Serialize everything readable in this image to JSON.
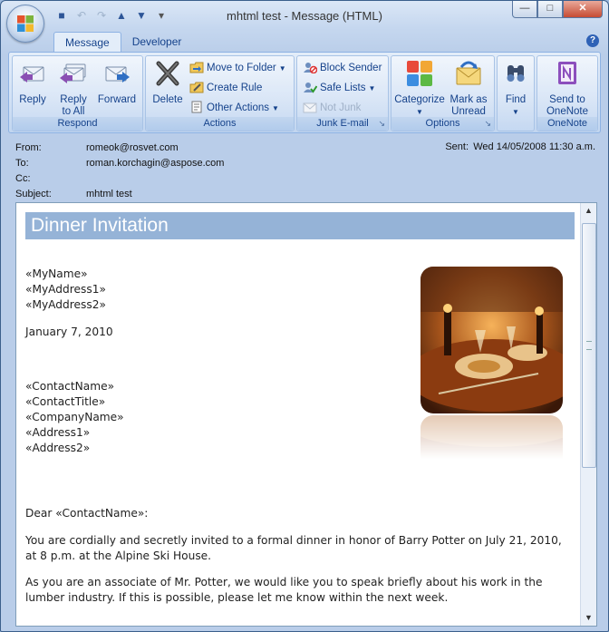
{
  "window": {
    "title": "mhtml test - Message (HTML)"
  },
  "tabs": [
    {
      "label": "Message"
    },
    {
      "label": "Developer"
    }
  ],
  "ribbon": {
    "respond": {
      "label": "Respond",
      "reply": "Reply",
      "reply_all_1": "Reply",
      "reply_all_2": "to All",
      "forward": "Forward"
    },
    "actions": {
      "label": "Actions",
      "delete": "Delete",
      "move_to_folder": "Move to Folder",
      "create_rule": "Create Rule",
      "other_actions": "Other Actions"
    },
    "junk": {
      "label": "Junk E-mail",
      "block_sender": "Block Sender",
      "safe_lists": "Safe Lists",
      "not_junk": "Not Junk"
    },
    "options": {
      "label": "Options",
      "categorize": "Categorize",
      "mark_as_1": "Mark as",
      "mark_as_2": "Unread"
    },
    "find": {
      "label": "Find"
    },
    "onenote": {
      "label": "OneNote",
      "send_1": "Send to",
      "send_2": "OneNote"
    }
  },
  "header": {
    "from_label": "From:",
    "from": "romeok@rosvet.com",
    "to_label": "To:",
    "to": "roman.korchagin@aspose.com",
    "cc_label": "Cc:",
    "cc": "",
    "subject_label": "Subject:",
    "subject": "mhtml test",
    "sent_label": "Sent:",
    "sent": "Wed 14/05/2008 11:30 a.m."
  },
  "body": {
    "banner": "Dinner Invitation",
    "sender_lines": [
      "«MyName»",
      "«MyAddress1»",
      "«MyAddress2»"
    ],
    "date": "January 7, 2010",
    "recipient_lines": [
      "«ContactName»",
      "«ContactTitle»",
      "«CompanyName»",
      "«Address1»",
      "«Address2»"
    ],
    "salutation": "Dear «ContactName»:",
    "paragraph1": "You are cordially and secretly invited to a formal dinner in honor of Barry Potter on July 21, 2010, at 8 p.m. at the Alpine Ski House.",
    "paragraph2": "As you are an associate of Mr. Potter, we would like you to speak briefly about his work in the lumber industry. If this is possible, please let me know within the next week."
  },
  "colors": {
    "banner": "#95b3d7",
    "ribbon_text": "#15428b",
    "close_button": "#c64b33"
  }
}
